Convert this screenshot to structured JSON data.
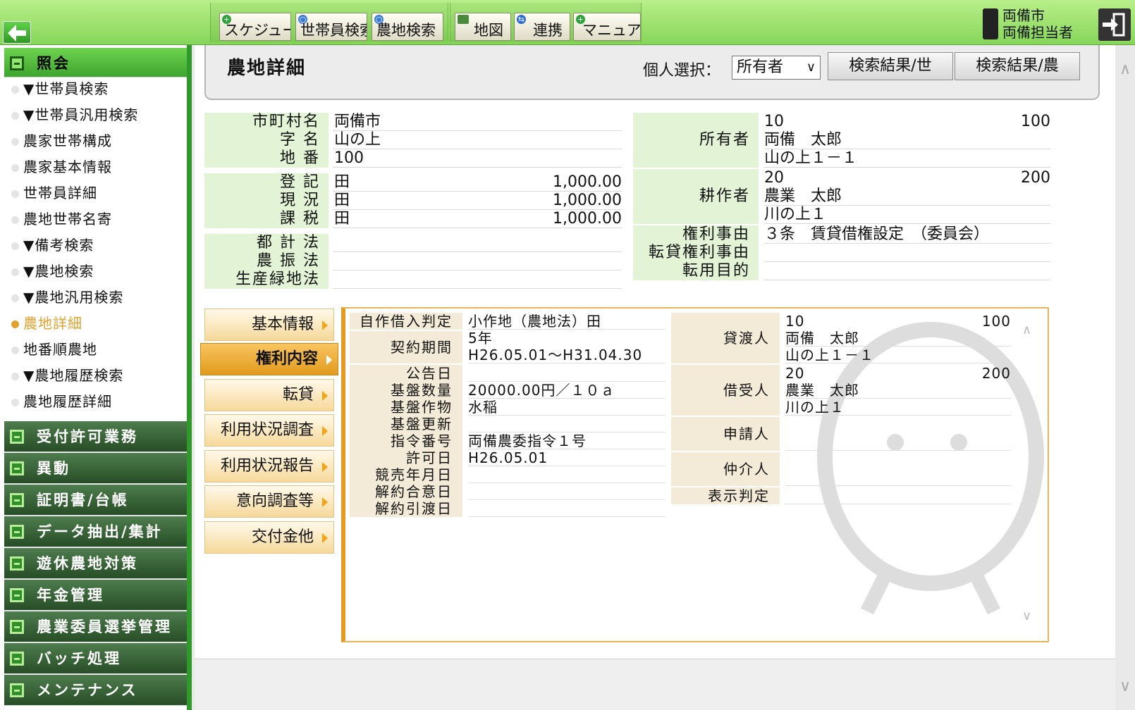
{
  "toolbar": {
    "buttons": [
      "スケジュール",
      "世帯員検索",
      "農地検索",
      "地図",
      "連携",
      "マニュアル"
    ]
  },
  "user": {
    "line1": "両備市",
    "line2": "両備担当者"
  },
  "sidebar": {
    "sections_top": {
      "label": "照会"
    },
    "items": [
      "▼世帯員検索",
      "▼世帯員汎用検索",
      "農家世帯構成",
      "農家基本情報",
      "世帯員詳細",
      "農地世帯名寄",
      "▼備考検索",
      "▼農地検索",
      "▼農地汎用検索",
      "農地詳細",
      "地番順農地",
      "▼農地履歴検索",
      "農地履歴詳細"
    ],
    "current_index": 9,
    "sections": [
      "受付許可業務",
      "異動",
      "証明書/台帳",
      "データ抽出/集計",
      "遊休農地対策",
      "年金管理",
      "農業委員選挙管理",
      "バッチ処理",
      "メンテナンス"
    ]
  },
  "header": {
    "title": "農地詳細",
    "select_label": "個人選択：",
    "select_value": "所有者",
    "btn1": "検索結果/世",
    "btn2": "検索結果/農"
  },
  "land": {
    "city_label": "市町村名",
    "city": "両備市",
    "aza_label": "字 名",
    "aza": "山の上",
    "chiban_label": "地 番",
    "chiban": "100",
    "touki_label": "登 記",
    "touki": "田",
    "touki_area": "1,000.00",
    "genkyo_label": "現 況",
    "genkyo": "田",
    "genkyo_area": "1,000.00",
    "kazei_label": "課 税",
    "kazei": "田",
    "kazei_area": "1,000.00",
    "tokei_label": "都 計 法",
    "noshin_label": "農 振 法",
    "ryokuchi_label": "生産緑地法"
  },
  "people": {
    "owner_label": "所有者",
    "owner_id": "10",
    "owner_no": "100",
    "owner_name": "両備　太郎",
    "owner_addr": "山の上１－１",
    "cultivator_label": "耕作者",
    "cultivator_id": "20",
    "cultivator_no": "200",
    "cultivator_name": "農業　太郎",
    "cultivator_addr": "川の上１",
    "right_reason_label": "権利事由",
    "right_reason": "３条　賃貸借権設定　（委員会）",
    "sublease_label": "転貸権利事由",
    "purpose_label": "転用目的"
  },
  "tabs": [
    "基本情報",
    "権利内容",
    "転貸",
    "利用状況調査",
    "利用状況報告",
    "意向調査等",
    "交付金他"
  ],
  "active_tab": 1,
  "rights": {
    "hantei_label": "自作借入判定",
    "hantei": "小作地（農地法）田",
    "period_label": "契約期間",
    "period_years": "5年",
    "period_range": "H26.05.01～H31.04.30",
    "kokoku_label": "公告日",
    "kiban_qty_label": "基盤数量",
    "kiban_qty": "20000.00円／１０ａ",
    "kiban_crop_label": "基盤作物",
    "kiban_crop": "水稲",
    "kiban_renew_label": "基盤更新",
    "order_no_label": "指令番号",
    "order_no": "両備農委指令１号",
    "permit_label": "許可日",
    "permit": "H26.05.01",
    "auction_label": "競売年月日",
    "cancel_agree_label": "解約合意日",
    "cancel_handover_label": "解約引渡日",
    "lessor_label": "貸渡人",
    "lessor_id": "10",
    "lessor_no": "100",
    "lessor_name": "両備　太郎",
    "lessor_addr": "山の上１－１",
    "lessee_label": "借受人",
    "lessee_id": "20",
    "lessee_no": "200",
    "lessee_name": "農業　太郎",
    "lessee_addr": "川の上１",
    "applicant_label": "申請人",
    "broker_label": "仲介人",
    "display_label": "表示判定"
  }
}
